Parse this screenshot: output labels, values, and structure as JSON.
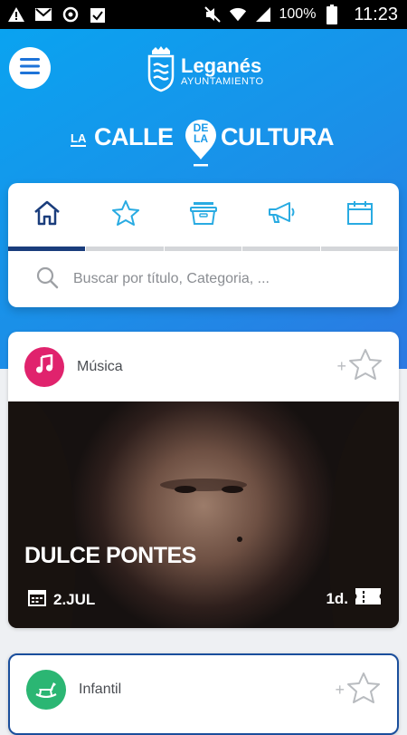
{
  "status_bar": {
    "left_icons": [
      "warning-icon",
      "mail-icon",
      "sync-icon",
      "clipboard-icon"
    ],
    "right_icons": [
      "mute-icon",
      "wifi-icon",
      "signal-icon",
      "battery-icon"
    ],
    "battery": "100%",
    "time": "11:23"
  },
  "header": {
    "brand": "Leganés",
    "brand_sub": "AYUNTAMIENTO",
    "calle_la": "LA",
    "calle_word": "CALLE",
    "pin_text_1": "DE",
    "pin_text_2": "LA",
    "cultura_word": "CULTURA",
    "colors": {
      "gradient_start": "#0aa3f0",
      "gradient_end": "#2c79e2"
    }
  },
  "tabs": [
    {
      "icon": "home-icon",
      "active": true
    },
    {
      "icon": "star-icon",
      "active": false
    },
    {
      "icon": "basket-icon",
      "active": false
    },
    {
      "icon": "megaphone-icon",
      "active": false
    },
    {
      "icon": "calendar-icon",
      "active": false
    }
  ],
  "search": {
    "placeholder": "Buscar por título, Categoria, ..."
  },
  "events": [
    {
      "category": "Música",
      "category_color": "#e0236d",
      "title": "DULCE PONTES",
      "date": "2.JUL",
      "duration": "1d.",
      "fav_plus": "+"
    },
    {
      "category": "Infantil",
      "category_color": "#2bb673",
      "fav_plus": "+"
    }
  ]
}
